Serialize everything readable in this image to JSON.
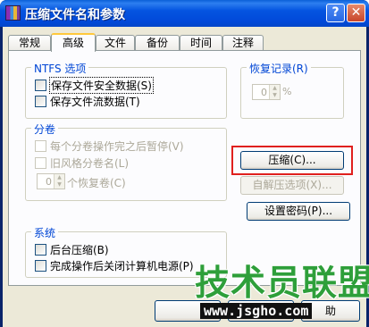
{
  "window": {
    "title": "压缩文件名和参数",
    "help_label": "?",
    "close_label": "✕"
  },
  "tabs": [
    "常规",
    "高级",
    "文件",
    "备份",
    "时间",
    "注释"
  ],
  "active_tab": "高级",
  "ntfs_group": {
    "label": "NTFS 选项",
    "options": [
      {
        "label": "保存文件安全数据(S)",
        "checked": false
      },
      {
        "label": "保存文件流数据(T)",
        "checked": false
      }
    ]
  },
  "recovery_group": {
    "label": "恢复记录(R)",
    "value": "0",
    "unit": "%"
  },
  "split_group": {
    "label": "分卷",
    "options": [
      {
        "label": "每个分卷操作完之后暂停(V)",
        "checked": false,
        "disabled": true
      },
      {
        "label": "旧风格分卷名(L)",
        "checked": false,
        "disabled": true
      }
    ],
    "recovery_volumes": {
      "value": "0",
      "label": "个恢复卷(C)"
    }
  },
  "system_group": {
    "label": "系统",
    "options": [
      {
        "label": "后台压缩(B)",
        "checked": false
      },
      {
        "label": "完成操作后关闭计算机电源(P)",
        "checked": false
      }
    ]
  },
  "buttons": {
    "compression": "压缩(C)...",
    "sfx_options": "自解压选项(X)...",
    "set_password": "设置密码(P)..."
  },
  "bottom_buttons": [
    "",
    "",
    "",
    "助"
  ],
  "watermark": {
    "logo": "技术员联盟",
    "url": "www.jsgho.com"
  },
  "colors": {
    "highlight": "#e0201e",
    "group_label": "#0046d5",
    "title_bar": "#0454e0"
  }
}
